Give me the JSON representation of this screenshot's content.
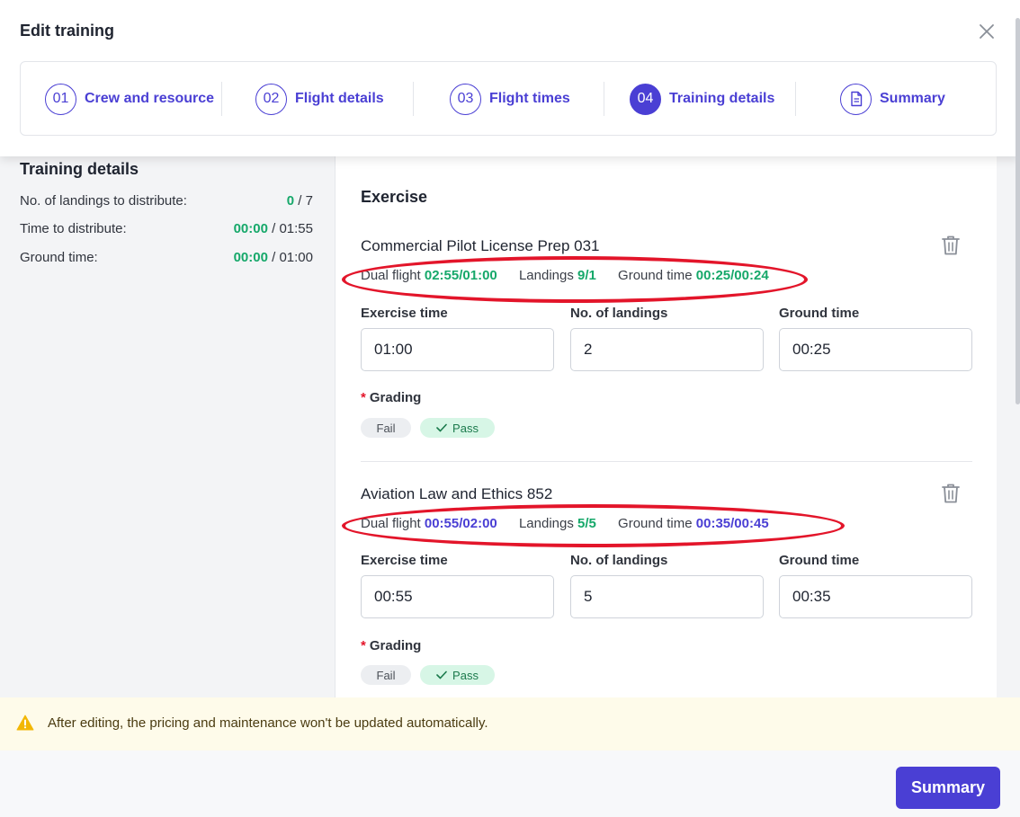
{
  "modal": {
    "title": "Edit training"
  },
  "steps": [
    {
      "number": "01",
      "label": "Crew and resource"
    },
    {
      "number": "02",
      "label": "Flight details"
    },
    {
      "number": "03",
      "label": "Flight times"
    },
    {
      "number": "04",
      "label": "Training details",
      "active": true
    },
    {
      "icon": "document-icon",
      "label": "Summary"
    }
  ],
  "sidebar": {
    "title": "Training details",
    "rows": [
      {
        "label": "No. of landings to distribute:",
        "value": "0",
        "total": " / 7"
      },
      {
        "label": "Time to distribute:",
        "value": "00:00",
        "total": " / 01:55"
      },
      {
        "label": "Ground time:",
        "value": "00:00",
        "total": " / 01:00"
      }
    ]
  },
  "main": {
    "section_title": "Exercise",
    "exercises": [
      {
        "name": "Commercial Pilot License Prep 031",
        "dual_flight_label": "Dual flight",
        "dual_flight_value": "02:55/01:00",
        "landings_label": "Landings",
        "landings_value": "9/1",
        "ground_time_label": "Ground time",
        "ground_time_value": "00:25/00:24",
        "stat_color": "#16a86a",
        "fields": {
          "exercise_time_label": "Exercise time",
          "exercise_time_value": "01:00",
          "landings_label": "No. of landings",
          "landings_value": "2",
          "ground_time_label": "Ground time",
          "ground_time_value": "00:25"
        },
        "grading_label": "Grading",
        "grading_fail": "Fail",
        "grading_pass": "Pass",
        "grading_selected": "Pass"
      },
      {
        "name": "Aviation Law and Ethics 852",
        "dual_flight_label": "Dual flight",
        "dual_flight_value": "00:55/02:00",
        "landings_label": "Landings",
        "landings_value": "5/5",
        "ground_time_label": "Ground time",
        "ground_time_value": "00:35/00:45",
        "fields": {
          "exercise_time_label": "Exercise time",
          "exercise_time_value": "00:55",
          "landings_label": "No. of landings",
          "landings_value": "5",
          "ground_time_label": "Ground time",
          "ground_time_value": "00:35"
        },
        "grading_label": "Grading",
        "grading_fail": "Fail",
        "grading_pass": "Pass",
        "grading_selected": "Pass"
      }
    ]
  },
  "warning": {
    "text": "After editing, the pricing and maintenance won't be updated automatically."
  },
  "footer": {
    "summary_button": "Summary"
  },
  "colors": {
    "accent": "#4a3fd4",
    "success": "#16a86a",
    "annotation_ring": "#e3152a",
    "warning_bg": "#fefbea"
  }
}
